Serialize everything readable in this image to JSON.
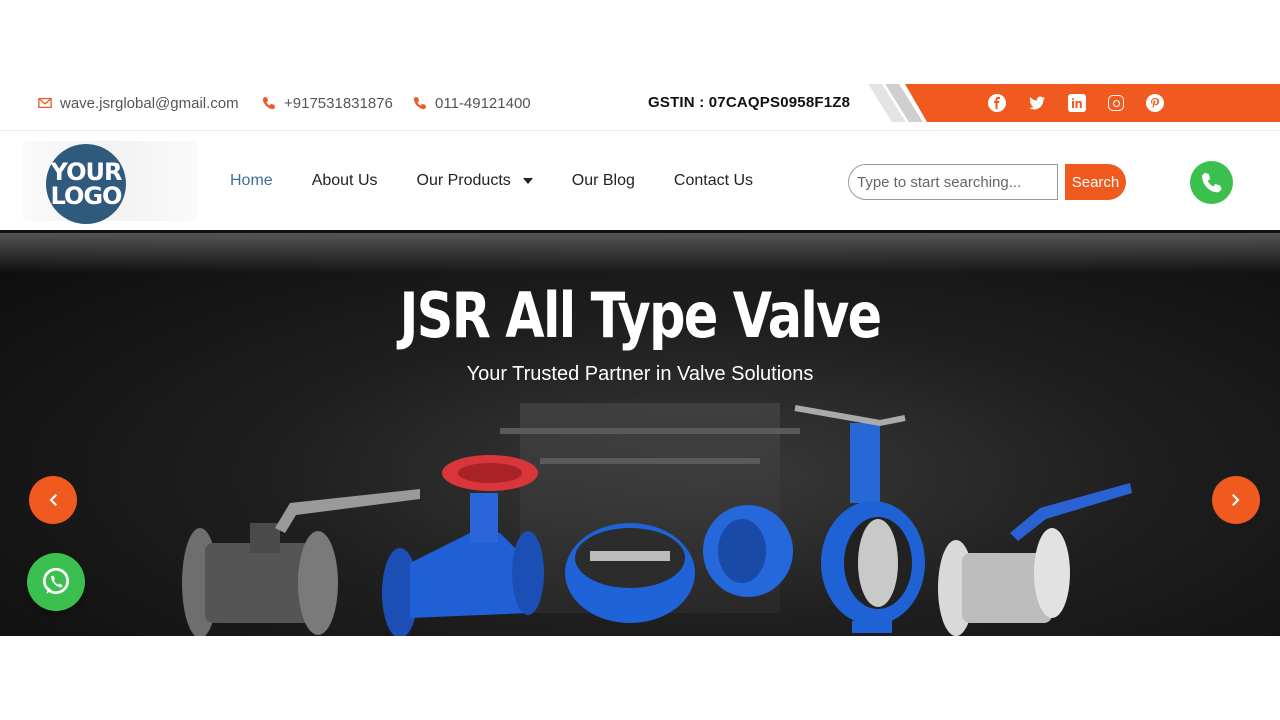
{
  "topbar": {
    "email": "wave.jsrglobal@gmail.com",
    "phone1": "+917531831876",
    "phone2": "011-49121400",
    "gstin": "GSTIN : 07CAQPS0958F1Z8",
    "socials": [
      "facebook-icon",
      "twitter-icon",
      "linkedin-icon",
      "instagram-icon",
      "pinterest-icon"
    ]
  },
  "header": {
    "logo_line1": "YOUR",
    "logo_line2": "LOGO",
    "nav": [
      "Home",
      "About Us",
      "Our Products",
      "Our Blog",
      "Contact Us"
    ],
    "active_nav": "Home",
    "search_placeholder": "Type to start searching...",
    "search_label": "Search"
  },
  "hero": {
    "title": "JSR All Type Valve",
    "subtitle": "Your Trusted Partner in Valve Solutions"
  },
  "colors": {
    "accent": "#f05a1e",
    "nav_active": "#3f6f98",
    "whatsapp": "#3bc04f",
    "valve_blue": "#1c5fd0",
    "handwheel_red": "#d8363a"
  }
}
